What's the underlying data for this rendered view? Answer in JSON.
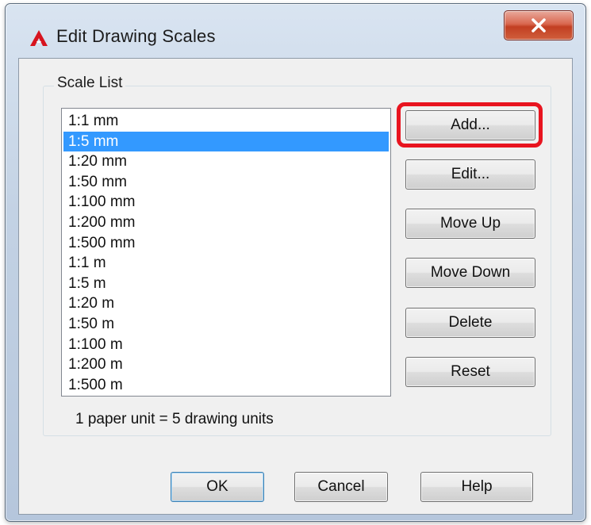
{
  "window": {
    "title": "Edit Drawing Scales",
    "app_icon": "autocad-a-icon",
    "close_icon": "close-x-icon"
  },
  "group": {
    "title": "Scale List"
  },
  "scale_list": {
    "items": [
      "1:1 mm",
      "1:5 mm",
      "1:20 mm",
      "1:50 mm",
      "1:100 mm",
      "1:200 mm",
      "1:500 mm",
      "1:1 m",
      "1:5 m",
      "1:20 m",
      "1:50 m",
      "1:100 m",
      "1:200 m",
      "1:500 m"
    ],
    "selected": "1:5 mm"
  },
  "side_buttons": {
    "add": "Add...",
    "edit": "Edit...",
    "move_up": "Move Up",
    "move_down": "Move Down",
    "delete": "Delete",
    "reset": "Reset"
  },
  "status": {
    "text": "1 paper unit = 5 drawing units"
  },
  "bottom_buttons": {
    "ok": "OK",
    "cancel": "Cancel",
    "help": "Help"
  },
  "colors": {
    "selection": "#3399ff",
    "highlight_ring": "#e8141f",
    "close_button": "#c23f22"
  }
}
